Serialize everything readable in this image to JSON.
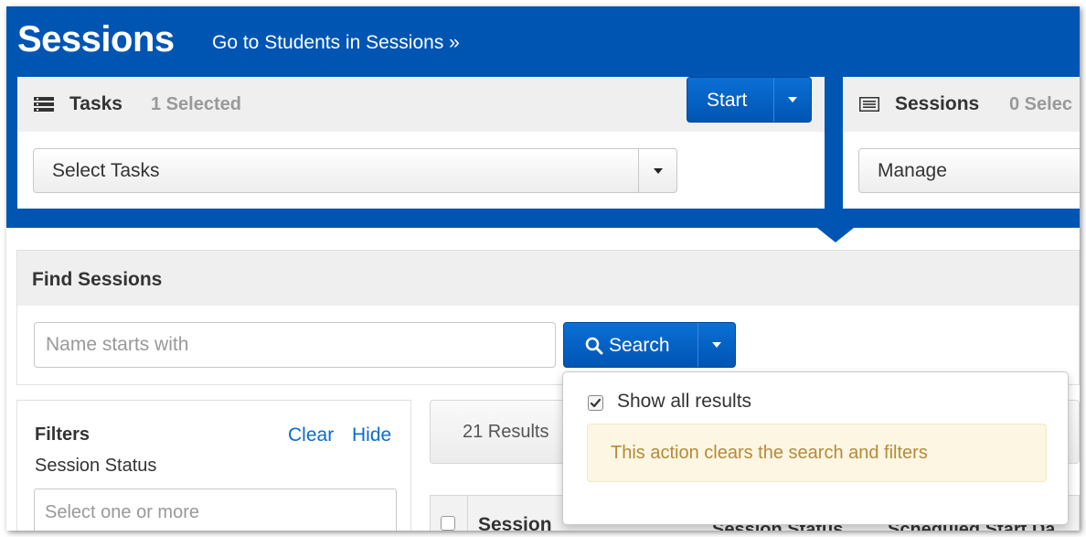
{
  "header": {
    "title": "Sessions",
    "goto_link": "Go to Students in Sessions »"
  },
  "tasks_panel": {
    "label": "Tasks",
    "selected_count": "1 Selected",
    "select_value": "Select Tasks",
    "start_label": "Start"
  },
  "sessions_panel": {
    "label": "Sessions",
    "selected_count": "0 Selec",
    "select_value": "Manage"
  },
  "find": {
    "title": "Find Sessions",
    "search_placeholder": "Name starts with",
    "search_label": "Search"
  },
  "filters": {
    "title": "Filters",
    "clear_label": "Clear",
    "hide_label": "Hide",
    "status_label": "Session Status",
    "status_placeholder": "Select one or more"
  },
  "results": {
    "count_text": "21 Results"
  },
  "table": {
    "columns": [
      "Session",
      "Session Status",
      "Scheduled Start Da"
    ]
  },
  "search_dropdown": {
    "show_all_label": "Show all results",
    "show_all_checked": true,
    "note": "This action clears the search and filters"
  },
  "colors": {
    "brand_blue": "#0055b3",
    "link_blue": "#0a6ccd",
    "note_bg": "#fcf6e3",
    "note_text": "#b58a3a"
  }
}
